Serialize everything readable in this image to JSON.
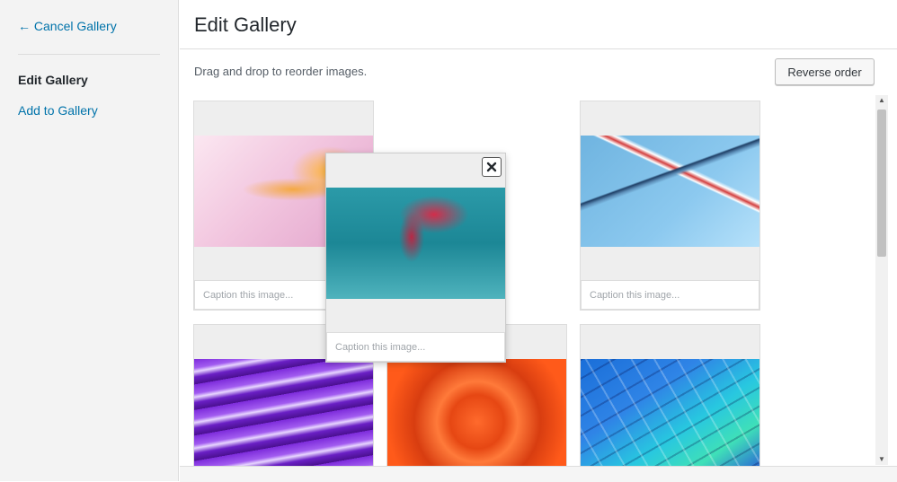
{
  "sidebar": {
    "cancel_label": "← Cancel Gallery",
    "items": [
      {
        "label": "Edit Gallery",
        "active": true
      },
      {
        "label": "Add to Gallery",
        "active": false
      }
    ]
  },
  "header": {
    "title": "Edit Gallery"
  },
  "toolbar": {
    "instructions": "Drag and drop to reorder images.",
    "reverse_label": "Reverse order"
  },
  "gallery": {
    "caption_placeholder": "Caption this image...",
    "images": [
      {
        "icon": "pink-flower-image"
      },
      {
        "icon": "blue-car-image"
      },
      {
        "icon": "purple-layers-image"
      },
      {
        "icon": "orange-swirl-image"
      },
      {
        "icon": "blue-balloon-image"
      }
    ],
    "dragging": {
      "icon": "red-flower-teal-image"
    }
  },
  "colors": {
    "link": "#0073aa",
    "sidebar_bg": "#f3f3f3",
    "tile_bg": "#eeeeee"
  }
}
